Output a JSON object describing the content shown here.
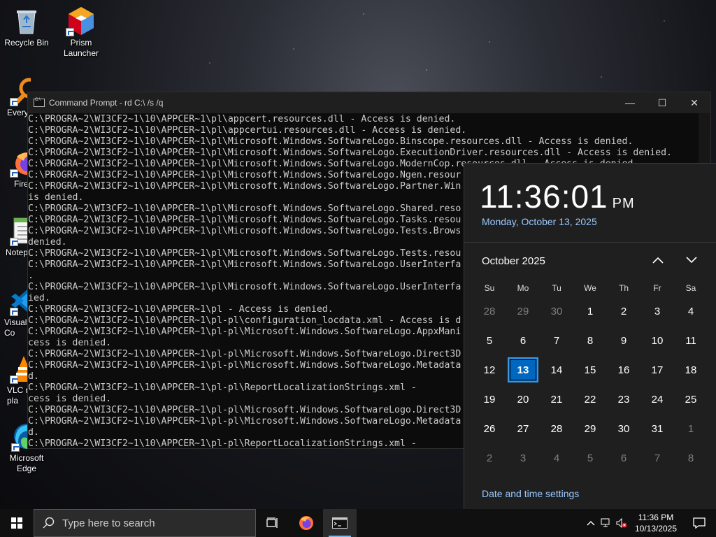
{
  "desktop": {
    "icons": [
      {
        "label": "Recycle Bin",
        "icon": "recycle-bin-icon"
      },
      {
        "label": "Prism\nLauncher",
        "icon": "prism-launcher-icon"
      },
      {
        "label": "Every",
        "icon": "everything-icon"
      },
      {
        "label": "Fire",
        "icon": "firefox-icon"
      },
      {
        "label": "Notep",
        "icon": "notepad-icon"
      },
      {
        "label": "Visual\nCo",
        "icon": "vscode-icon"
      },
      {
        "label": "VLC r\npla",
        "icon": "vlc-icon"
      },
      {
        "label": "Microsoft\nEdge",
        "icon": "edge-icon"
      }
    ]
  },
  "cmd": {
    "title": "Command Prompt - rd  C:\\ /s /q",
    "lines": [
      "C:\\PROGRA~2\\WI3CF2~1\\10\\APPCER~1\\pl\\appcert.resources.dll - Access is denied.",
      "C:\\PROGRA~2\\WI3CF2~1\\10\\APPCER~1\\pl\\appcertui.resources.dll - Access is denied.",
      "C:\\PROGRA~2\\WI3CF2~1\\10\\APPCER~1\\pl\\Microsoft.Windows.SoftwareLogo.Binscope.resources.dll - Access is denied.",
      "C:\\PROGRA~2\\WI3CF2~1\\10\\APPCER~1\\pl\\Microsoft.Windows.SoftwareLogo.ExecutionDriver.resources.dll - Access is denied.",
      "C:\\PROGRA~2\\WI3CF2~1\\10\\APPCER~1\\pl\\Microsoft.Windows.SoftwareLogo.ModernCop.resources.dll - Access is denied.",
      "C:\\PROGRA~2\\WI3CF2~1\\10\\APPCER~1\\pl\\Microsoft.Windows.SoftwareLogo.Ngen.resour",
      "C:\\PROGRA~2\\WI3CF2~1\\10\\APPCER~1\\pl\\Microsoft.Windows.SoftwareLogo.Partner.Win",
      "is denied.",
      "C:\\PROGRA~2\\WI3CF2~1\\10\\APPCER~1\\pl\\Microsoft.Windows.SoftwareLogo.Shared.reso",
      "C:\\PROGRA~2\\WI3CF2~1\\10\\APPCER~1\\pl\\Microsoft.Windows.SoftwareLogo.Tasks.resou",
      "C:\\PROGRA~2\\WI3CF2~1\\10\\APPCER~1\\pl\\Microsoft.Windows.SoftwareLogo.Tests.Brows",
      "denied.",
      "C:\\PROGRA~2\\WI3CF2~1\\10\\APPCER~1\\pl\\Microsoft.Windows.SoftwareLogo.Tests.resou",
      "C:\\PROGRA~2\\WI3CF2~1\\10\\APPCER~1\\pl\\Microsoft.Windows.SoftwareLogo.UserInterfa",
      ".",
      "C:\\PROGRA~2\\WI3CF2~1\\10\\APPCER~1\\pl\\Microsoft.Windows.SoftwareLogo.UserInterfa",
      "ied.",
      "C:\\PROGRA~2\\WI3CF2~1\\10\\APPCER~1\\pl - Access is denied.",
      "C:\\PROGRA~2\\WI3CF2~1\\10\\APPCER~1\\pl-pl\\configuration_locdata.xml - Access is d",
      "C:\\PROGRA~2\\WI3CF2~1\\10\\APPCER~1\\pl-pl\\Microsoft.Windows.SoftwareLogo.AppxMani",
      "cess is denied.",
      "C:\\PROGRA~2\\WI3CF2~1\\10\\APPCER~1\\pl-pl\\Microsoft.Windows.SoftwareLogo.Direct3D",
      "C:\\PROGRA~2\\WI3CF2~1\\10\\APPCER~1\\pl-pl\\Microsoft.Windows.SoftwareLogo.Metadata",
      "d.",
      "C:\\PROGRA~2\\WI3CF2~1\\10\\APPCER~1\\pl-pl\\ReportLocalizationStrings.xml -",
      "cess is denied.",
      "C:\\PROGRA~2\\WI3CF2~1\\10\\APPCER~1\\pl-pl\\Microsoft.Windows.SoftwareLogo.Direct3D",
      "C:\\PROGRA~2\\WI3CF2~1\\10\\APPCER~1\\pl-pl\\Microsoft.Windows.SoftwareLogo.Metadata",
      "d.",
      "C:\\PROGRA~2\\WI3CF2~1\\10\\APPCER~1\\pl-pl\\ReportLocalizationStrings.xml -"
    ]
  },
  "calendar": {
    "time": "11:36:01",
    "ampm": "PM",
    "long_date": "Monday, October 13, 2025",
    "month_label": "October 2025",
    "weekdays": [
      "Su",
      "Mo",
      "Tu",
      "We",
      "Th",
      "Fr",
      "Sa"
    ],
    "weeks": [
      [
        {
          "d": "28",
          "dim": true
        },
        {
          "d": "29",
          "dim": true
        },
        {
          "d": "30",
          "dim": true
        },
        {
          "d": "1"
        },
        {
          "d": "2"
        },
        {
          "d": "3"
        },
        {
          "d": "4"
        }
      ],
      [
        {
          "d": "5"
        },
        {
          "d": "6"
        },
        {
          "d": "7"
        },
        {
          "d": "8"
        },
        {
          "d": "9"
        },
        {
          "d": "10"
        },
        {
          "d": "11"
        }
      ],
      [
        {
          "d": "12"
        },
        {
          "d": "13",
          "today": true
        },
        {
          "d": "14"
        },
        {
          "d": "15"
        },
        {
          "d": "16"
        },
        {
          "d": "17"
        },
        {
          "d": "18"
        }
      ],
      [
        {
          "d": "19"
        },
        {
          "d": "20"
        },
        {
          "d": "21"
        },
        {
          "d": "22"
        },
        {
          "d": "23"
        },
        {
          "d": "24"
        },
        {
          "d": "25"
        }
      ],
      [
        {
          "d": "26"
        },
        {
          "d": "27"
        },
        {
          "d": "28"
        },
        {
          "d": "29"
        },
        {
          "d": "30"
        },
        {
          "d": "31"
        },
        {
          "d": "1",
          "dim": true
        }
      ],
      [
        {
          "d": "2",
          "dim": true
        },
        {
          "d": "3",
          "dim": true
        },
        {
          "d": "4",
          "dim": true
        },
        {
          "d": "5",
          "dim": true
        },
        {
          "d": "6",
          "dim": true
        },
        {
          "d": "7",
          "dim": true
        },
        {
          "d": "8",
          "dim": true
        }
      ]
    ],
    "settings_link": "Date and time settings"
  },
  "taskbar": {
    "search_placeholder": "Type here to search",
    "clock_time": "11:36 PM",
    "clock_date": "10/13/2025"
  },
  "colors": {
    "accent": "#0067c0",
    "link": "#99c9ff"
  }
}
